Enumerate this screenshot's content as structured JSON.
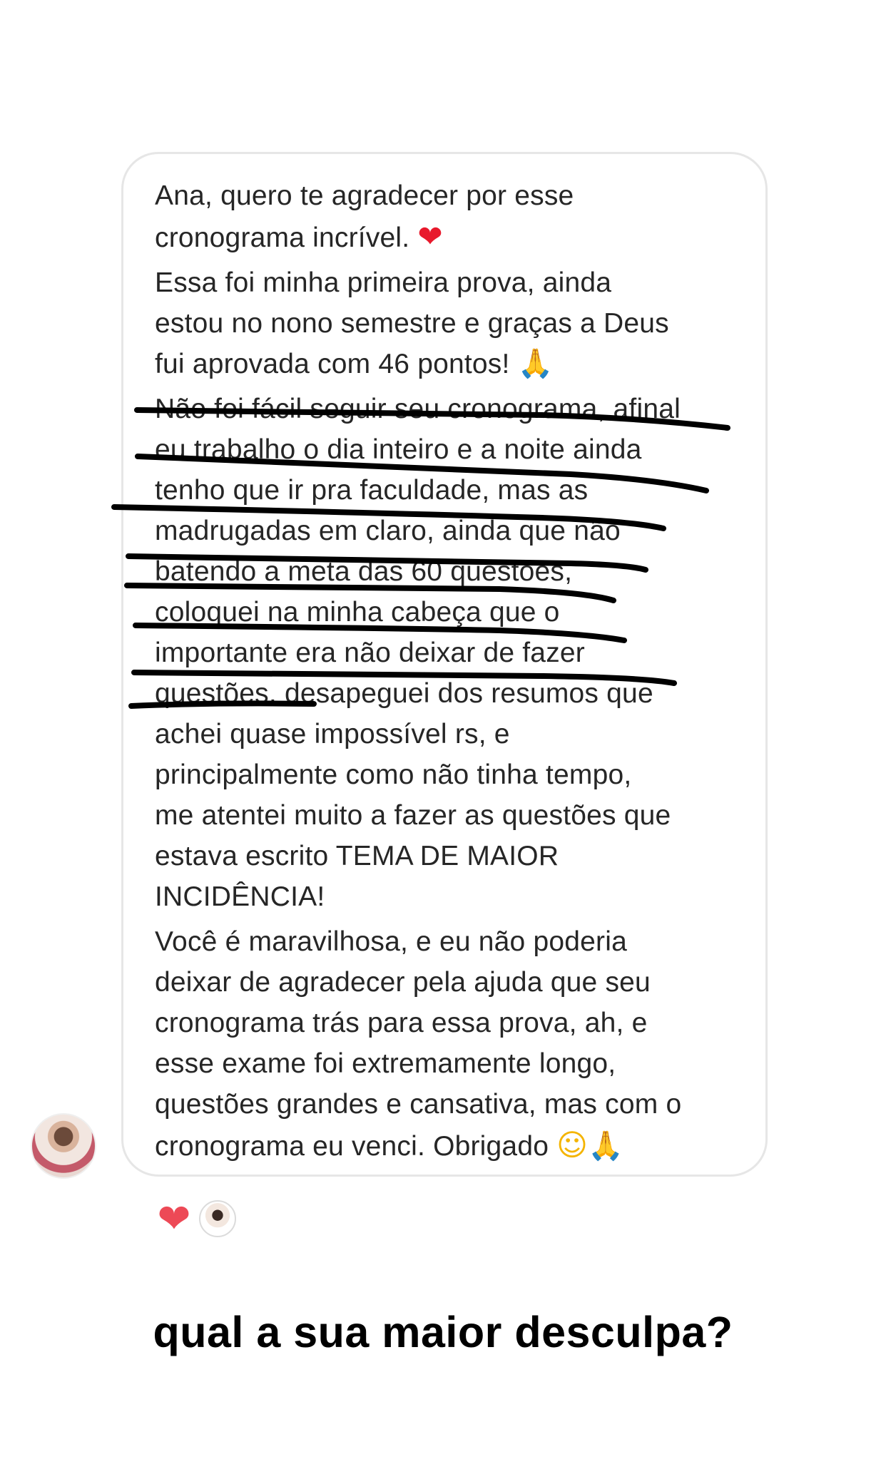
{
  "message": {
    "paragraphs": [
      "Ana, quero te agradecer por esse\ncronograma incrível.",
      "Essa foi minha primeira prova, ainda\nestou no nono semestre e graças a Deus\nfui aprovada com 46 pontos!",
      "Não foi fácil seguir seu cronograma, afinal\neu trabalho o dia inteiro e a noite ainda\ntenho que ir pra faculdade, mas as\nmadrugadas em claro, ainda que não\nbatendo a meta das 60 questões,\ncoloquei na minha cabeça que o\nimportante era não deixar de fazer\nquestões, desapeguei dos resumos que\nachei quase impossível rs, e\nprincipalmente como não tinha tempo,\nme atentei muito a fazer as questões que\nestava escrito TEMA DE MAIOR\nINCIDÊNCIA!",
      "Você é maravilhosa, e eu não poderia\ndeixar de agradecer pela ajuda que seu\ncronograma trás para essa prova, ah, e\nesse exame foi extremamente longo,\nquestões grandes e cansativa, mas com o\ncronograma eu venci. Obrigado"
    ],
    "emoji": {
      "heart": "❤",
      "pray": "🙏",
      "smile": "☺"
    }
  },
  "reactions": {
    "heart": "❤"
  },
  "story_question": "qual a sua maior desculpa?",
  "colors": {
    "bubble_border": "#e6e6e6",
    "reaction_heart": "#ed4956",
    "strike_ink": "#000000"
  },
  "icons": [
    "heart-emoji-icon",
    "praying-hands-emoji-icon",
    "smiling-face-emoji-icon",
    "heart-reaction-icon"
  ]
}
